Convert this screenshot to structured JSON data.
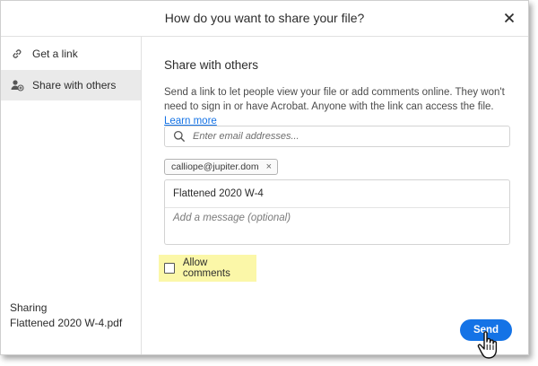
{
  "dialog": {
    "title": "How do you want to share your file?"
  },
  "sidebar": {
    "items": [
      {
        "label": "Get a link",
        "icon": "link-icon",
        "selected": false
      },
      {
        "label": "Share with others",
        "icon": "add-person-icon",
        "selected": true
      }
    ],
    "sharing_label": "Sharing",
    "file_name": "Flattened 2020 W-4.pdf"
  },
  "main": {
    "section_title": "Share with others",
    "description": "Send a link to let people view your file or add comments online. They won't need to sign in or have Acrobat. Anyone with the link can access the file.",
    "learn_more": "Learn more",
    "email_placeholder": "Enter email addresses...",
    "recipients": [
      "calliope@jupiter.dom"
    ],
    "subject": "Flattened 2020 W-4",
    "message_placeholder": "Add a message (optional)",
    "allow_comments_label": "Allow comments",
    "allow_comments_checked": false,
    "send_label": "Send"
  },
  "colors": {
    "accent": "#1473e6",
    "highlight": "#fbf7a8",
    "selected_bg": "#eaeaea"
  }
}
